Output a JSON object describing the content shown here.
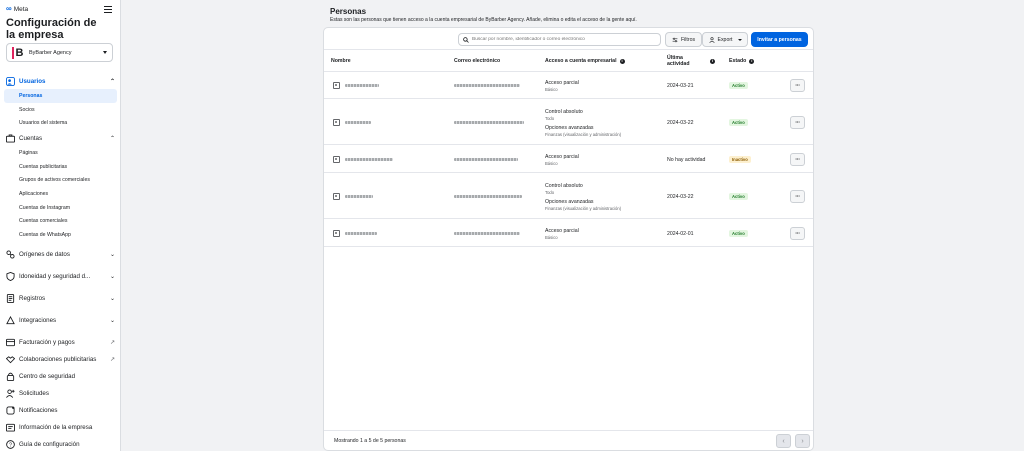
{
  "brand": {
    "logo_text": "Meta"
  },
  "sidebar": {
    "title": "Configuración de la empresa",
    "account": {
      "name": "ByBarber Agency",
      "initial": "B"
    },
    "sections": [
      {
        "label": "Usuarios",
        "icon": "users-icon",
        "active": true,
        "expanded": true,
        "items": [
          {
            "label": "Personas",
            "active": true
          },
          {
            "label": "Socios"
          },
          {
            "label": "Usuarios del sistema"
          }
        ]
      },
      {
        "label": "Cuentas",
        "icon": "briefcase-icon",
        "expanded": true,
        "items": [
          {
            "label": "Páginas"
          },
          {
            "label": "Cuentas publicitarias"
          },
          {
            "label": "Grupos de activos comerciales"
          },
          {
            "label": "Aplicaciones"
          },
          {
            "label": "Cuentas de Instagram"
          },
          {
            "label": "Cuentas comerciales"
          },
          {
            "label": "Cuentas de WhatsApp"
          }
        ]
      },
      {
        "label": "Orígenes de datos",
        "icon": "data-sources-icon"
      },
      {
        "label": "Idoneidad y seguridad d...",
        "icon": "shield-icon"
      },
      {
        "label": "Registros",
        "icon": "document-icon"
      },
      {
        "label": "Integraciones",
        "icon": "integrations-icon"
      }
    ],
    "links": [
      {
        "label": "Facturación y pagos",
        "icon": "billing-icon",
        "external": true
      },
      {
        "label": "Colaboraciones publicitarias",
        "icon": "handshake-icon",
        "external": true
      },
      {
        "label": "Centro de seguridad",
        "icon": "lock-icon"
      },
      {
        "label": "Solicitudes",
        "icon": "person-add-icon"
      },
      {
        "label": "Notificaciones",
        "icon": "bell-icon"
      },
      {
        "label": "Información de la empresa",
        "icon": "building-icon"
      },
      {
        "label": "Guía de configuración",
        "icon": "help-icon"
      }
    ]
  },
  "header": {
    "title": "Personas",
    "subtitle": "Estas son las personas que tienen acceso a la cuenta empresarial de ByBarber Agency. Añade, elimina o edita el acceso de la gente aquí."
  },
  "toolbar": {
    "search_placeholder": "Buscar por nombre, identificador o correo electrónico",
    "filter_label": "Filtros",
    "export_label": "Export",
    "invite_label": "Invitar a personas"
  },
  "table": {
    "columns": {
      "name": "Nombre",
      "email": "Correo electrónico",
      "access": "Acceso a cuenta empresarial",
      "last_activity": "Última actividad",
      "status": "Estado"
    },
    "rows": [
      {
        "access": [
          {
            "title": "Acceso parcial",
            "detail": "Básico"
          }
        ],
        "last_activity": "2024-03-21",
        "status": "Activo"
      },
      {
        "access": [
          {
            "title": "Control absoluto",
            "detail": "Todo"
          },
          {
            "title": "Opciones avanzadas",
            "detail": "Finanzas (visualización y administración)"
          }
        ],
        "last_activity": "2024-03-22",
        "status": "Activo"
      },
      {
        "access": [
          {
            "title": "Acceso parcial",
            "detail": "Básico"
          }
        ],
        "last_activity": "No hay actividad",
        "status": "Inactivo"
      },
      {
        "access": [
          {
            "title": "Control absoluto",
            "detail": "Todo"
          },
          {
            "title": "Opciones avanzadas",
            "detail": "Finanzas (visualización y administración)"
          }
        ],
        "last_activity": "2024-03-22",
        "status": "Activo"
      },
      {
        "access": [
          {
            "title": "Acceso parcial",
            "detail": "Básico"
          }
        ],
        "last_activity": "2024-02-01",
        "status": "Activo"
      }
    ]
  },
  "footer": {
    "count_text": "Mostrando 1 a 5 de 5 personas"
  },
  "colors": {
    "accent": "#0064e0",
    "active_badge": "#e3f6e0",
    "inactive_badge": "#fdf0cf"
  }
}
